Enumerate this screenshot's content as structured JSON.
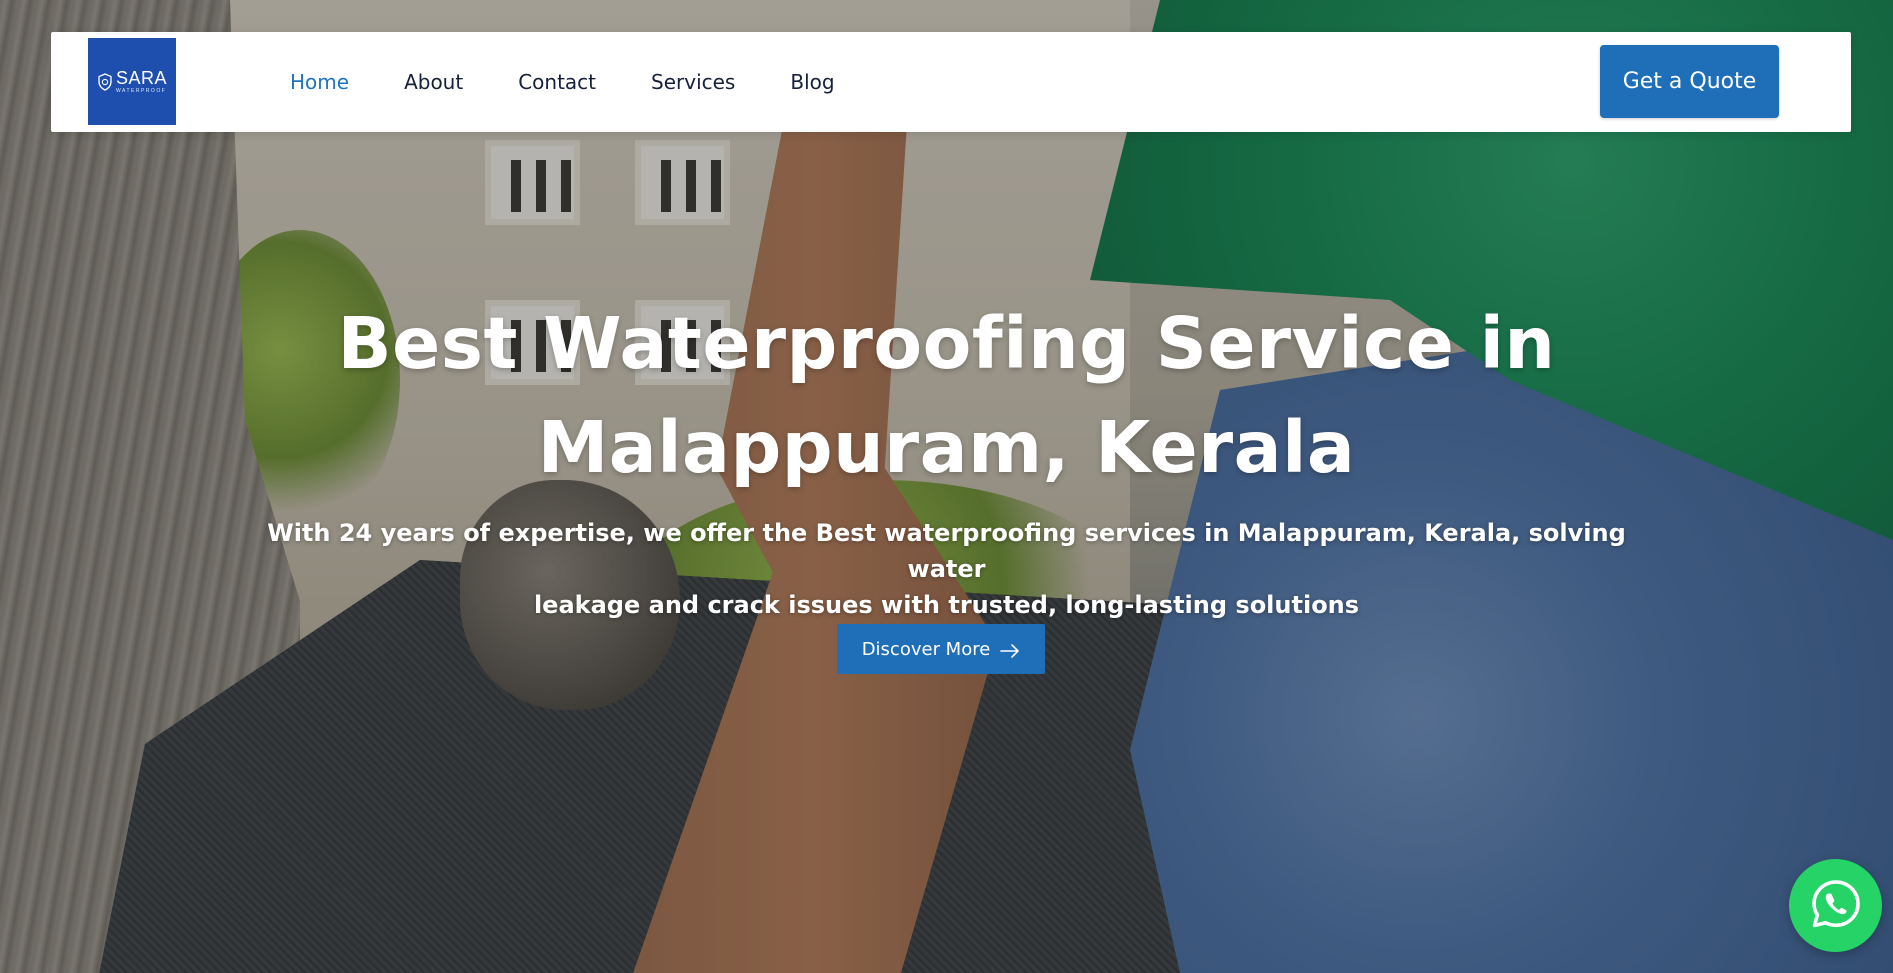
{
  "brand": {
    "logo_name": "SARA",
    "logo_sub": "WATERPROOF",
    "colors": {
      "primary": "#1f6fb8",
      "logo_bg": "#1f4fae",
      "nav_active": "#1f74c0",
      "whatsapp": "#25d366"
    }
  },
  "nav": {
    "items": [
      {
        "label": "Home",
        "active": true
      },
      {
        "label": "About",
        "active": false
      },
      {
        "label": "Contact",
        "active": false
      },
      {
        "label": "Services",
        "active": false
      },
      {
        "label": "Blog",
        "active": false
      }
    ],
    "cta_label": "Get a Quote"
  },
  "hero": {
    "title_line1": "Best Waterproofing Service in",
    "title_line2": "Malappuram, Kerala",
    "subtitle_line1": "With 24 years of expertise, we offer the Best waterproofing services in Malappuram, Kerala, solving water",
    "subtitle_line2": "leakage and crack issues with trusted, long-lasting solutions",
    "button_label": "Discover More",
    "button_icon": "arrow-right-icon"
  },
  "floating": {
    "icon": "whatsapp-icon"
  }
}
